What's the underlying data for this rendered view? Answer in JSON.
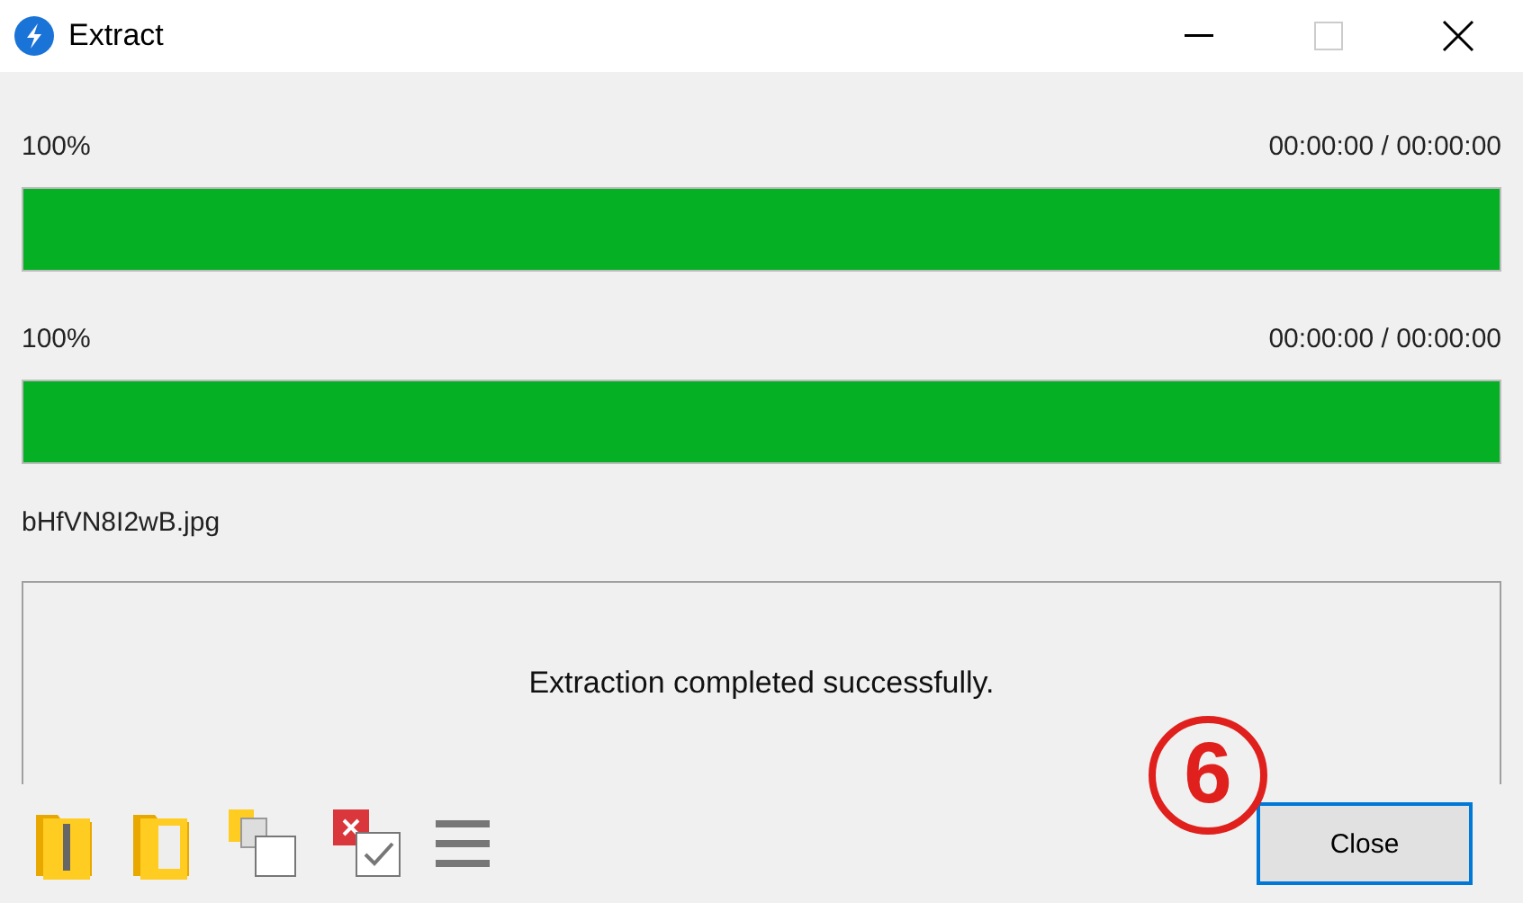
{
  "window": {
    "title": "Extract"
  },
  "progress": [
    {
      "percent": "100%",
      "time": "00:00:00 / 00:00:00",
      "level": 1
    },
    {
      "percent": "100%",
      "time": "00:00:00 / 00:00:00",
      "level": 1
    }
  ],
  "current_file": "bHfVN8I2wB.jpg",
  "message": "Extraction completed successfully.",
  "buttons": [
    {
      "label": "Close",
      "selected": true
    }
  ],
  "annotation": {
    "label": "6"
  }
}
